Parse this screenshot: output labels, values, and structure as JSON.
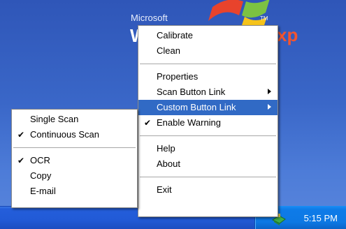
{
  "desktop": {
    "logo_word": "Microsoft",
    "logo_tm": "TM",
    "logo_w": "W",
    "logo_xp": "xp"
  },
  "taskbar": {
    "clock": "5:15 PM",
    "tray_icon": "scanner-tray-icon"
  },
  "main_menu": {
    "items": [
      {
        "label": "Calibrate"
      },
      {
        "label": "Clean"
      },
      {
        "label": "Properties"
      },
      {
        "label": "Scan Button Link"
      },
      {
        "label": "Custom Button Link"
      },
      {
        "label": "Enable Warning"
      },
      {
        "label": "Help"
      },
      {
        "label": "About"
      },
      {
        "label": "Exit"
      }
    ],
    "checkmark": "✔"
  },
  "sub_menu": {
    "items": [
      {
        "label": "Single Scan"
      },
      {
        "label": "Continuous Scan"
      },
      {
        "label": "OCR"
      },
      {
        "label": "Copy"
      },
      {
        "label": "E-mail"
      }
    ],
    "checkmark": "✔"
  },
  "colors": {
    "highlight": "#316ac5",
    "desktop_blue": "#3a67c8",
    "taskbar_blue": "#245edb",
    "tray_blue": "#0e7be8"
  }
}
